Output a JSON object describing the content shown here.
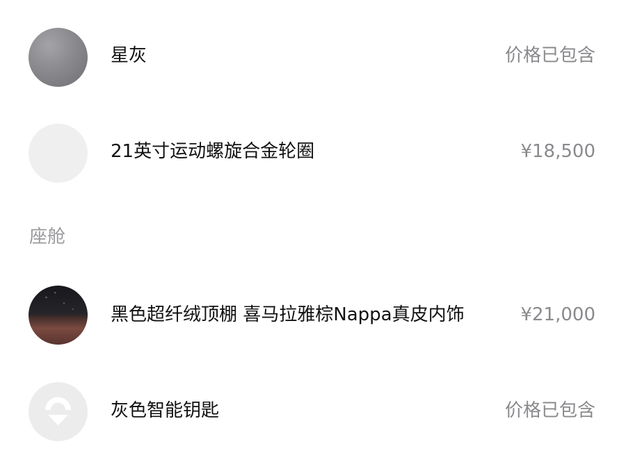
{
  "section_cabin_label": "座舱",
  "items": [
    {
      "name": "星灰",
      "price": "价格已包含",
      "swatch": "gray-icon"
    },
    {
      "name": "21英寸运动螺旋合金轮圈",
      "price": "¥18,500",
      "swatch": "wheel-icon"
    },
    {
      "name": "黑色超纤绒顶棚 喜马拉雅棕Nappa真皮内饰",
      "price": "¥21,000",
      "swatch": "interior-icon"
    },
    {
      "name": "灰色智能钥匙",
      "price": "价格已包含",
      "swatch": "nio-logo-icon"
    }
  ]
}
